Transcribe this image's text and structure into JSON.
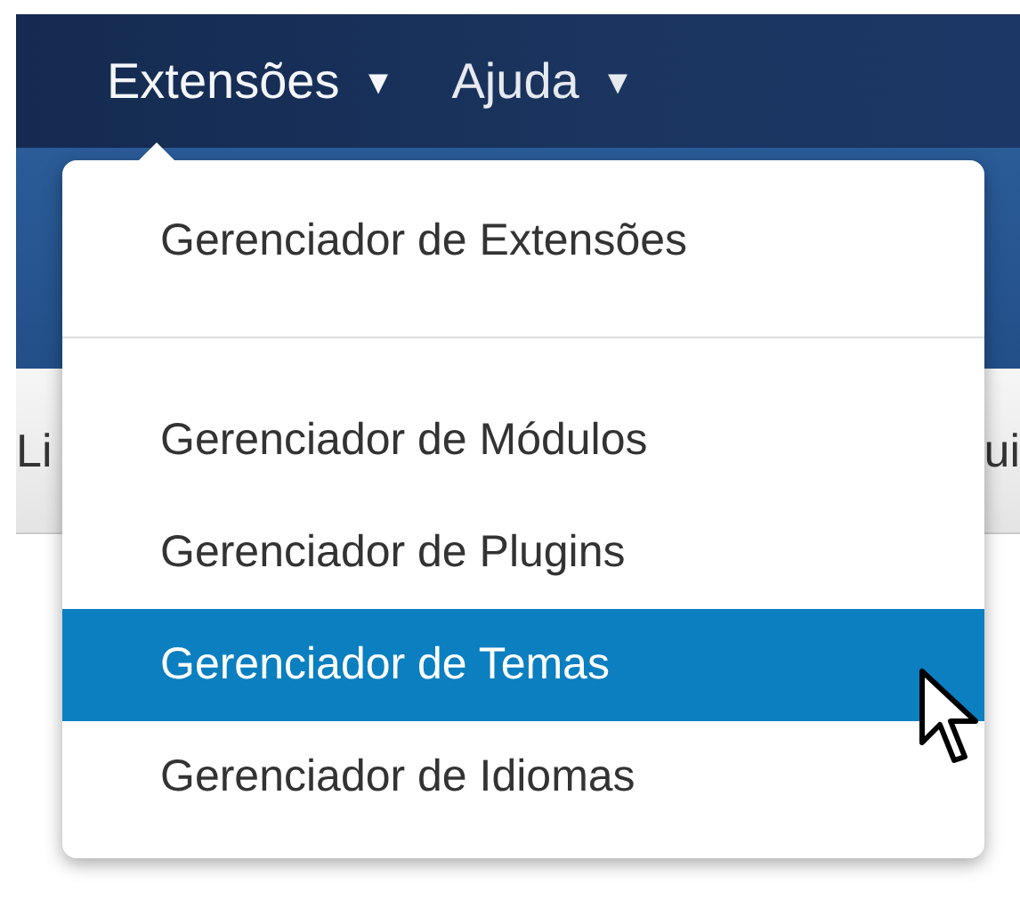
{
  "navbar": {
    "items": [
      {
        "label": "Extensões",
        "caret": "▾",
        "expanded": true
      },
      {
        "label": "Ajuda",
        "caret": "▾",
        "expanded": false
      }
    ]
  },
  "toolbar": {
    "left_text": "Li",
    "right_text": "ui"
  },
  "dropdown_menu": {
    "sections": [
      [
        {
          "label": "Gerenciador de Extensões",
          "selected": false
        }
      ],
      [
        {
          "label": "Gerenciador de Módulos",
          "selected": false
        },
        {
          "label": "Gerenciador de Plugins",
          "selected": false
        },
        {
          "label": "Gerenciador de Temas",
          "selected": true
        },
        {
          "label": "Gerenciador de Idiomas",
          "selected": false
        }
      ]
    ]
  }
}
